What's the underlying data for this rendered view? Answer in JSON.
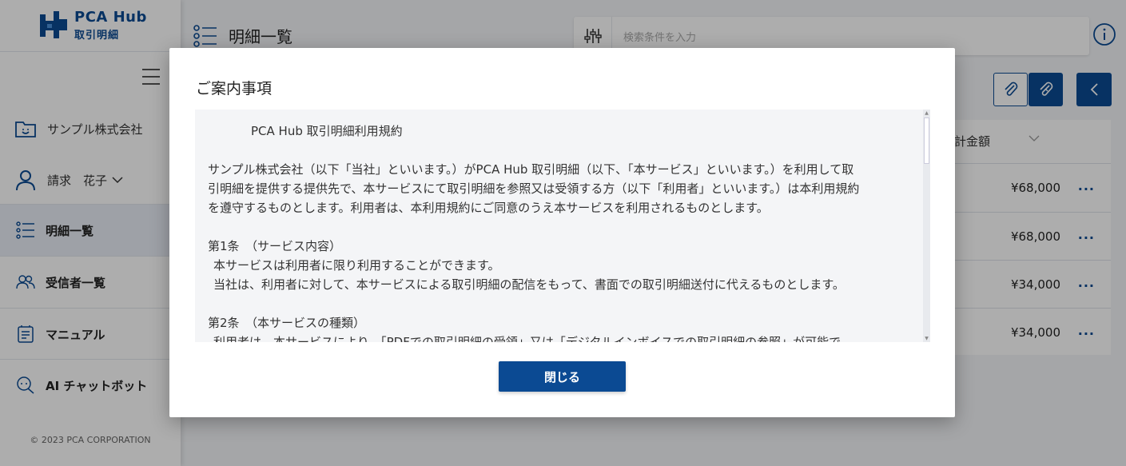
{
  "app": {
    "logo_title": "PCA Hub",
    "logo_subtitle": "取引明細",
    "accent_color": "#0b4a93"
  },
  "sidebar": {
    "company": "サンプル株式会社",
    "user": "請求　花子",
    "items": [
      {
        "label": "明細一覧",
        "icon": "list-icon",
        "active": true
      },
      {
        "label": "受信者一覧",
        "icon": "users-icon",
        "active": false
      },
      {
        "label": "マニュアル",
        "icon": "manual-icon",
        "active": false
      },
      {
        "label": "AI チャットボット",
        "icon": "chatbot-icon",
        "active": false
      }
    ],
    "copyright": "© 2023 PCA CORPORATION"
  },
  "header": {
    "page_title": "明細一覧",
    "search_placeholder": "検索条件を入力"
  },
  "table": {
    "amount_header": "計金額",
    "rows": [
      {
        "amount": "¥68,000",
        "more": "···"
      },
      {
        "amount": "¥68,000",
        "more": "···"
      },
      {
        "amount": "¥34,000",
        "more": "···"
      },
      {
        "amount": "¥34,000",
        "more": "···"
      }
    ]
  },
  "modal": {
    "title": "ご案内事項",
    "terms_title": "PCA Hub 取引明細利用規約",
    "intro": [
      "サンプル株式会社（以下「当社」といいます。）がPCA Hub 取引明細（以下、「本サービス」といいます。）を利用して取",
      "引明細を提供する提供先で、本サービスにて取引明細を参照又は受領する方（以下「利用者」といいます。）は本利用規約",
      "を遵守するものとします。利用者は、本利用規約にご同意のうえ本サービスを利用されるものとします。"
    ],
    "article1_title": "第1条　（サービス内容）",
    "article1_lines": [
      "本サービスは利用者に限り利用することができます。",
      "当社は、利用者に対して、本サービスによる取引明細の配信をもって、書面での取引明細送付に代えるものとします。"
    ],
    "article2_title": "第2条　（本サービスの種類）",
    "article2_partial": "利用者は、本サービスにより、「PDFでの取引明細の受領」又は「デジタルインボイスでの取引明細の参照」が可能で",
    "close_label": "閉じる"
  }
}
